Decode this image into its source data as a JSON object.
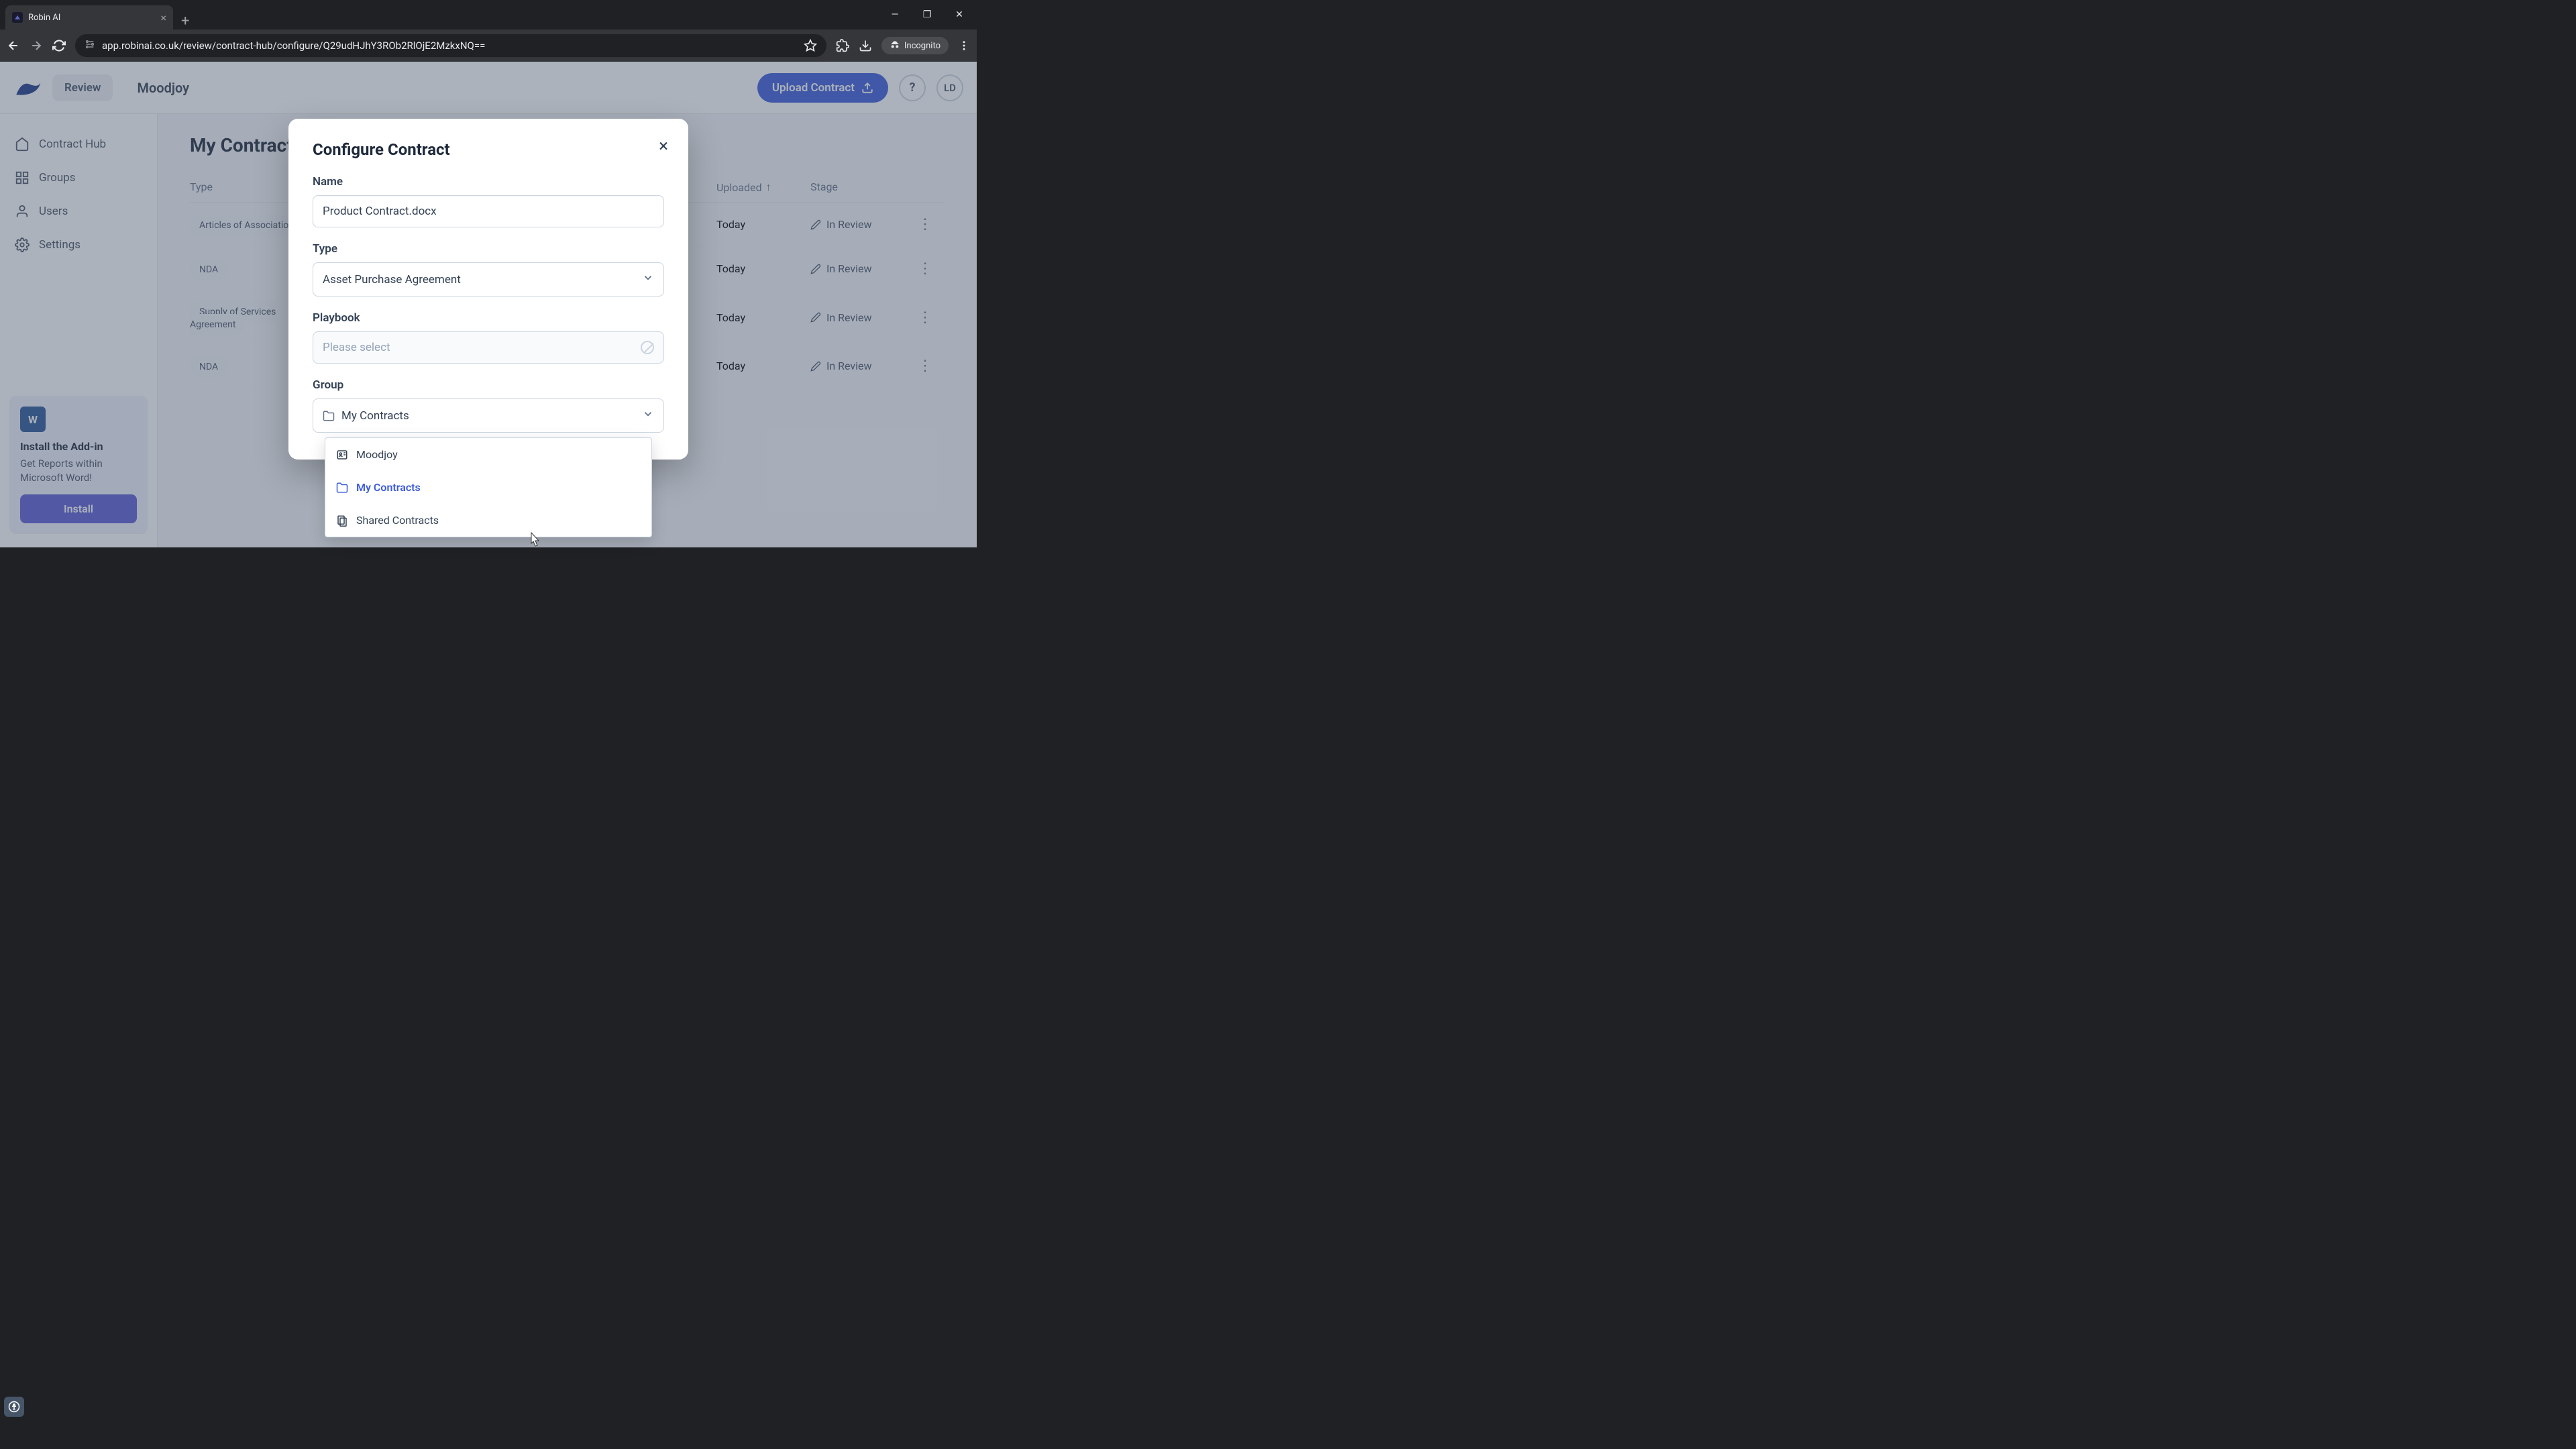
{
  "browser": {
    "tab_title": "Robin AI",
    "url": "app.robinai.co.uk/review/contract-hub/configure/Q29udHJhY3ROb2RlOjE2MzkxNQ==",
    "incognito_label": "Incognito"
  },
  "header": {
    "review_label": "Review",
    "org_name": "Moodjoy",
    "upload_label": "Upload Contract",
    "avatar_initials": "LD"
  },
  "sidebar": {
    "items": [
      {
        "label": "Contract Hub"
      },
      {
        "label": "Groups"
      },
      {
        "label": "Users"
      },
      {
        "label": "Settings"
      }
    ],
    "addin": {
      "title": "Install the Add-in",
      "desc": "Get Reports within Microsoft Word!",
      "button": "Install"
    }
  },
  "main": {
    "title": "My Contracts",
    "columns": {
      "type": "Type",
      "uploaded": "Uploaded",
      "stage": "Stage"
    },
    "rows": [
      {
        "type": "Articles of Association",
        "uploaded": "Today",
        "stage": "In Review"
      },
      {
        "type": "NDA",
        "uploaded": "Today",
        "stage": "In Review"
      },
      {
        "type": "Supply of Services Agreement",
        "uploaded": "Today",
        "stage": "In Review"
      },
      {
        "type": "NDA",
        "uploaded": "Today",
        "stage": "In Review"
      }
    ]
  },
  "modal": {
    "title": "Configure Contract",
    "name_label": "Name",
    "name_value": "Product Contract.docx",
    "type_label": "Type",
    "type_value": "Asset Purchase Agreement",
    "playbook_label": "Playbook",
    "playbook_placeholder": "Please select",
    "group_label": "Group",
    "group_value": "My Contracts",
    "group_options": [
      {
        "label": "Moodjoy",
        "icon": "contact"
      },
      {
        "label": "My Contracts",
        "icon": "folder",
        "selected": true
      },
      {
        "label": "Shared Contracts",
        "icon": "shared"
      }
    ]
  }
}
